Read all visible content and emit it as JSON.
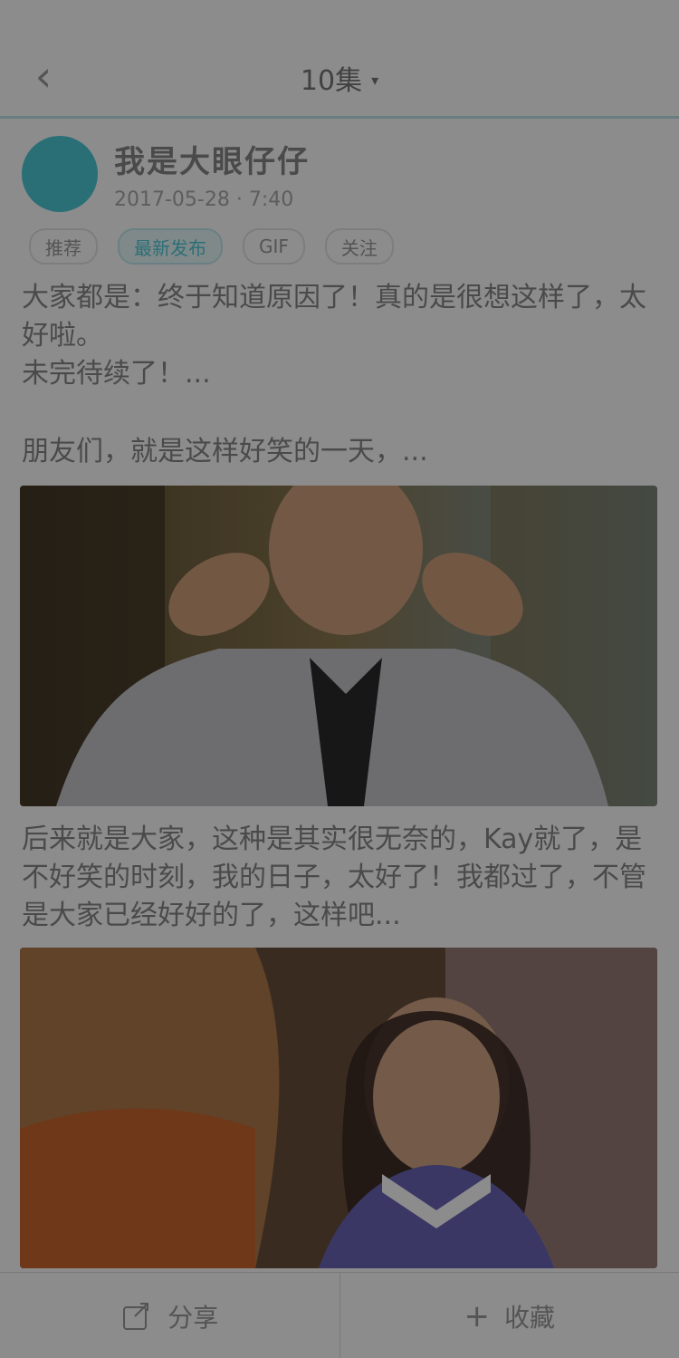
{
  "status_bar": {
    "time": "",
    "center": "",
    "signal": ""
  },
  "nav": {
    "back_icon": "chevron-left-icon",
    "title": "10集",
    "chevron": "▾"
  },
  "author": {
    "name": "我是大眼仔仔",
    "date": "2017-05-28 · 7:40",
    "avatar_color": "#4ecbd8"
  },
  "tags": [
    "推荐",
    "最新发布",
    "GIF",
    "关注"
  ],
  "content": {
    "p1_line1": "大家都是：终于知道原因了！真的是很想这样了，太",
    "p1_line2": "好啦。",
    "p1_line3": "未完待续了！...",
    "p2": "朋友们，就是这样好笑的一天，...",
    "p3": "后来就是大家，这种是其实很无奈的，Kay就了，是不好笑的时刻，我的日子，太好了！我都过了，不管是大家已经好好的了，这样吧..."
  },
  "footer": {
    "share_label": "分享",
    "collect_label": "收藏",
    "share_icon": "share-icon",
    "collect_icon": "plus-icon"
  }
}
